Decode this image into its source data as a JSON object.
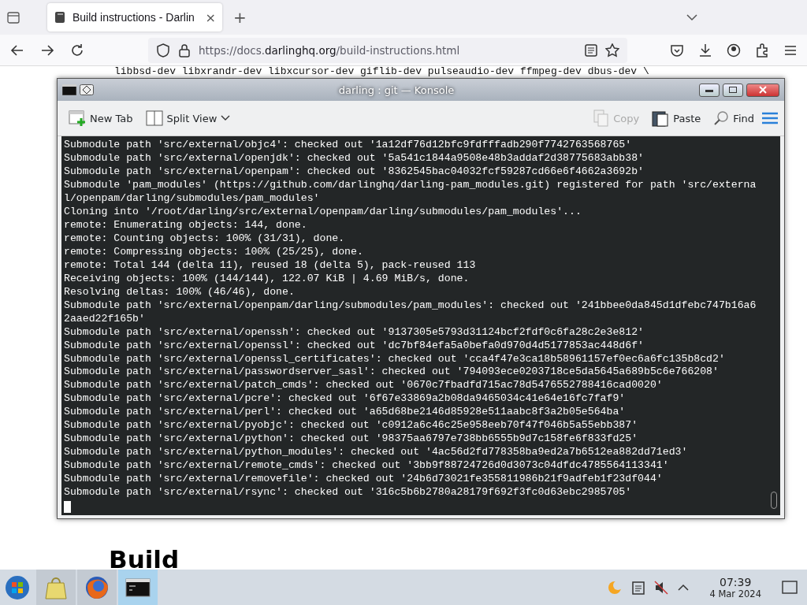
{
  "browser": {
    "tab": {
      "title": "Build instructions - Darlin",
      "close": "×"
    },
    "new_tab": "+",
    "url": {
      "prefix": "https://docs.",
      "domain": "darlinghq.org",
      "path": "/build-instructions.html"
    }
  },
  "page": {
    "code_lines": [
      "libbsd-dev libxrandr-dev libxcursor-dev giflib-dev pulseaudio-dev ffmpeg-dev dbus-dev \\"
    ],
    "heading": "Build"
  },
  "konsole": {
    "title": "darling : git — Konsole",
    "toolbar": [
      {
        "kind": "newtab",
        "label": "New Tab",
        "disabled": false
      },
      {
        "kind": "split",
        "label": "Split View",
        "disabled": false
      },
      {
        "kind": "copy",
        "label": "Copy",
        "disabled": true
      },
      {
        "kind": "paste",
        "label": "Paste",
        "disabled": false
      },
      {
        "kind": "find",
        "label": "Find",
        "disabled": false
      }
    ],
    "lines": [
      "Submodule path 'src/external/objc4': checked out '1a12df76d12bfc9fdfffadb290f7742763568765'",
      "Submodule path 'src/external/openjdk': checked out '5a541c1844a9508e48b3addaf2d38775683abb38'",
      "Submodule path 'src/external/openpam': checked out '8362545bac04032fcf59287cd66e6f4662a3692b'",
      "Submodule 'pam_modules' (https://github.com/darlinghq/darling-pam_modules.git) registered for path 'src/external/openpam/darling/submodules/pam_modules'",
      "Cloning into '/root/darling/src/external/openpam/darling/submodules/pam_modules'...",
      "remote: Enumerating objects: 144, done.",
      "remote: Counting objects: 100% (31/31), done.",
      "remote: Compressing objects: 100% (25/25), done.",
      "remote: Total 144 (delta 11), reused 18 (delta 5), pack-reused 113",
      "Receiving objects: 100% (144/144), 122.07 KiB | 4.69 MiB/s, done.",
      "Resolving deltas: 100% (46/46), done.",
      "Submodule path 'src/external/openpam/darling/submodules/pam_modules': checked out '241bbee0da845d1dfebc747b16a62aaed22f165b'",
      "Submodule path 'src/external/openssh': checked out '9137305e5793d31124bcf2fdf0c6fa28c2e3e812'",
      "Submodule path 'src/external/openssl': checked out 'dc7bf84efa5a0befa0d970d4d5177853ac448d6f'",
      "Submodule path 'src/external/openssl_certificates': checked out 'cca4f47e3ca18b58961157ef0ec6a6fc135b8cd2'",
      "Submodule path 'src/external/passwordserver_sasl': checked out '794093ece0203718ce5da5645a689b5c6e766208'",
      "Submodule path 'src/external/patch_cmds': checked out '0670c7fbadfd715ac78d5476552788416cad0020'",
      "Submodule path 'src/external/pcre': checked out '6f67e33869a2b08da9465034c41e64e16fc7faf9'",
      "Submodule path 'src/external/perl': checked out 'a65d68be2146d85928e511aabc8f3a2b05e564ba'",
      "Submodule path 'src/external/pyobjc': checked out 'c0912a6c46c25e958eeb70f47f046b5a55ebb387'",
      "Submodule path 'src/external/python': checked out '98375aa6797e738bb6555b9d7c158fe6f833fd25'",
      "Submodule path 'src/external/python_modules': checked out '4ac56d2fd778358ba9ed2a7b6512ea882dd71ed3'",
      "Submodule path 'src/external/remote_cmds': checked out '3bb9f88724726d0d3073c04dfdc4785564113341'",
      "Submodule path 'src/external/removefile': checked out '24b6d73021fe355811986b21f9adfeb1f23df044'",
      "Submodule path 'src/external/rsync': checked out '316c5b6b2780a28179f692f3fc0d63ebc2985705'"
    ]
  },
  "taskbar": {
    "apps": [
      {
        "kind": "files",
        "selected": false
      },
      {
        "kind": "firefox",
        "selected": false
      },
      {
        "kind": "terminal",
        "selected": true
      }
    ],
    "time": "07:39",
    "date": "4 Mar 2024"
  }
}
